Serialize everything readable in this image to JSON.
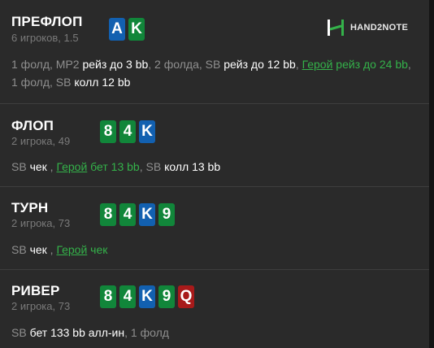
{
  "streets": [
    {
      "name": "ПРЕФЛОП",
      "info": "6 игроков, 1.5",
      "cards": [
        {
          "rank": "A",
          "suit": "d"
        },
        {
          "rank": "K",
          "suit": "c"
        }
      ],
      "actions": [
        {
          "text": "1 фолд, ",
          "style": "g"
        },
        {
          "text": "MP2 ",
          "style": "g"
        },
        {
          "text": "рейз до 3 bb",
          "style": "w"
        },
        {
          "text": ", 2 фолда, ",
          "style": "g"
        },
        {
          "text": "SB ",
          "style": "g"
        },
        {
          "text": "рейз до 12 bb",
          "style": "w"
        },
        {
          "text": ", ",
          "style": "g"
        },
        {
          "text": "Герой",
          "style": "hu"
        },
        {
          "text": " рейз до 24 bb",
          "style": "h"
        },
        {
          "text": ", 1 фолд, ",
          "style": "g"
        },
        {
          "text": "SB ",
          "style": "g"
        },
        {
          "text": "колл 12 bb",
          "style": "w"
        }
      ]
    },
    {
      "name": "ФЛОП",
      "info": "2 игрока, 49",
      "cards": [
        {
          "rank": "8",
          "suit": "c"
        },
        {
          "rank": "4",
          "suit": "c"
        },
        {
          "rank": "K",
          "suit": "d"
        }
      ],
      "actions": [
        {
          "text": "SB ",
          "style": "g"
        },
        {
          "text": "чек",
          "style": "w"
        },
        {
          "text": " , ",
          "style": "g"
        },
        {
          "text": "Герой",
          "style": "hu"
        },
        {
          "text": " бет 13 bb",
          "style": "h"
        },
        {
          "text": ", ",
          "style": "g"
        },
        {
          "text": "SB ",
          "style": "g"
        },
        {
          "text": "колл 13 bb",
          "style": "w"
        }
      ]
    },
    {
      "name": "ТУРН",
      "info": "2 игрока, 73",
      "cards": [
        {
          "rank": "8",
          "suit": "c"
        },
        {
          "rank": "4",
          "suit": "c"
        },
        {
          "rank": "K",
          "suit": "d"
        },
        {
          "rank": "9",
          "suit": "c"
        }
      ],
      "actions": [
        {
          "text": "SB ",
          "style": "g"
        },
        {
          "text": "чек",
          "style": "w"
        },
        {
          "text": " , ",
          "style": "g"
        },
        {
          "text": "Герой",
          "style": "hu"
        },
        {
          "text": " чек",
          "style": "h"
        }
      ]
    },
    {
      "name": "РИВЕР",
      "info": "2 игрока, 73",
      "cards": [
        {
          "rank": "8",
          "suit": "c"
        },
        {
          "rank": "4",
          "suit": "c"
        },
        {
          "rank": "K",
          "suit": "d"
        },
        {
          "rank": "9",
          "suit": "c"
        },
        {
          "rank": "Q",
          "suit": "h"
        }
      ],
      "actions": [
        {
          "text": "SB ",
          "style": "g"
        },
        {
          "text": "бет 133 bb алл-ин",
          "style": "w"
        },
        {
          "text": ", 1 фолд",
          "style": "g"
        }
      ]
    }
  ],
  "logo": {
    "text": "HAND2NOTE",
    "icon": "h2n-logo-icon"
  },
  "colors": {
    "clubs": "#11863a",
    "diamonds": "#1260b0",
    "hearts": "#a81a1a",
    "hero": "#34b24a"
  }
}
